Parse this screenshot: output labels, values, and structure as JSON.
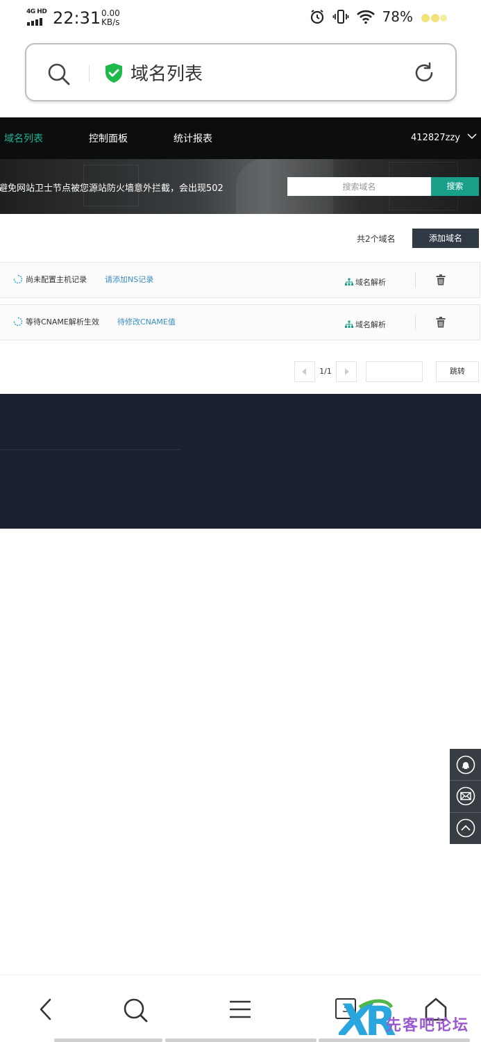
{
  "status_bar": {
    "network": "4G HD",
    "time": "22:31",
    "speed_value": "0.00",
    "speed_unit": "KB/s",
    "battery": "78%"
  },
  "address_bar": {
    "title": "域名列表",
    "icons": [
      "search-icon",
      "shield-check-icon",
      "reload-icon"
    ],
    "shield_color": "#1fb84a"
  },
  "nav": {
    "items": [
      {
        "label": "域名列表",
        "active": true
      },
      {
        "label": "控制面板",
        "active": false
      },
      {
        "label": "统计报表",
        "active": false
      }
    ],
    "user": "412827zzy",
    "accent": "#1cb394"
  },
  "banner": {
    "notice": "避免网站卫士节点被您源站防火墙意外拦截，会出现502",
    "search_placeholder": "搜索域名",
    "search_button": "搜索"
  },
  "list": {
    "count_label": "共2个域名",
    "add_button": "添加域名",
    "rows": [
      {
        "status": "尚未配置主机记录",
        "hint": "请添加NS记录",
        "action": "域名解析"
      },
      {
        "status": "等待CNAME解析生效",
        "hint": "待修改CNAME值",
        "action": "域名解析"
      }
    ]
  },
  "pagination": {
    "page_info": "1/1",
    "go_button": "跳转"
  },
  "floating": {
    "icons": [
      "qq-icon",
      "mail-icon",
      "scroll-top-icon"
    ]
  },
  "bottom_bar": {
    "tab_count": "3",
    "icons": [
      "back-icon",
      "search-icon",
      "menu-icon",
      "tabs-icon",
      "home-icon"
    ]
  },
  "watermark": {
    "text": "先客吧论坛"
  },
  "colors": {
    "footer_bg": "#1a2232",
    "search_button_bg": "#1aa08a",
    "add_button_bg": "#2f3a45",
    "link": "#3a8fc2"
  }
}
